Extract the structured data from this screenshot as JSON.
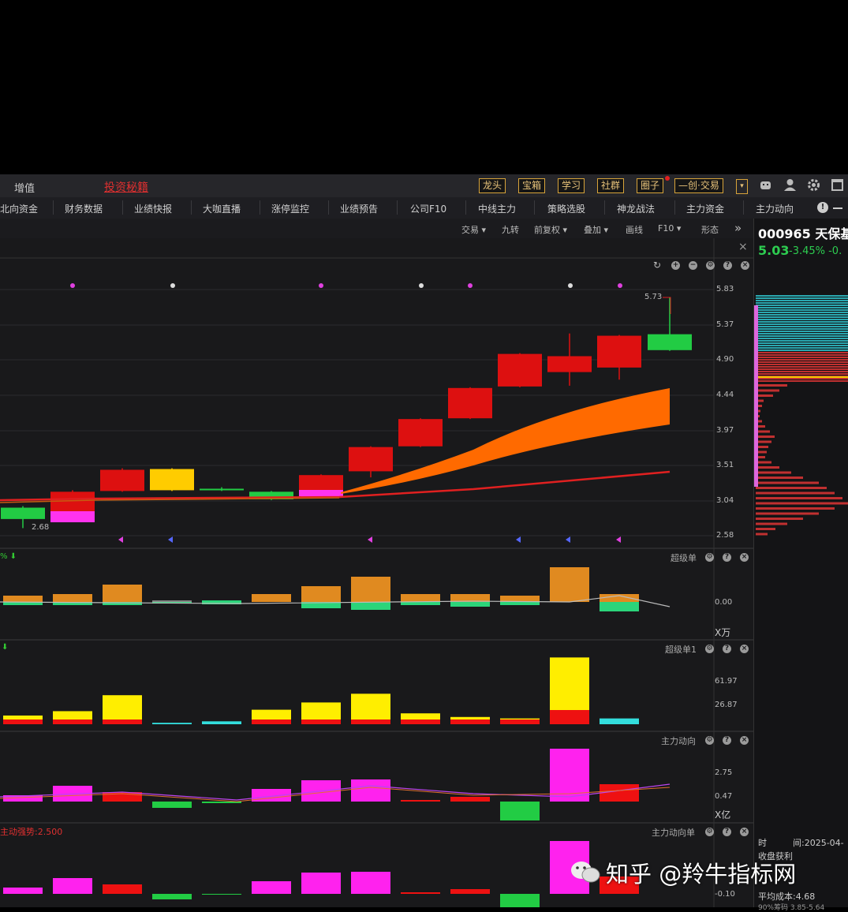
{
  "toolbar": {
    "left_label": "增值",
    "promo_label": "投资秘籍",
    "buttons": [
      "龙头",
      "宝箱",
      "学习",
      "社群",
      "圈子",
      "—创·交易"
    ]
  },
  "nav": {
    "items": [
      "北向资金",
      "财务数据",
      "业绩快报",
      "大咖直播",
      "涨停监控",
      "业绩预告",
      "公司F10",
      "中线主力",
      "策略选股",
      "神龙战法",
      "主力资金",
      "主力动向"
    ]
  },
  "chart_toolbar": {
    "items": [
      "交易 ▾",
      "九转",
      "前复权 ▾",
      "叠加 ▾",
      "画线",
      "F10 ▾",
      "形态"
    ]
  },
  "stock": {
    "title": "000965 天保基",
    "price": "5.03",
    "change": "-3.45% -0."
  },
  "chart_data": [
    {
      "type": "candlestick",
      "title": "",
      "y_ticks": [
        "5.83",
        "5.37",
        "4.90",
        "4.44",
        "3.97",
        "3.51",
        "3.04",
        "2.58"
      ],
      "ylim": [
        2.58,
        5.83
      ],
      "annotations": [
        "5.73",
        "2.68"
      ],
      "candles": [
        {
          "o": 2.95,
          "c": 2.8,
          "h": 2.97,
          "l": 2.68,
          "color": "#22cc44"
        },
        {
          "o": 2.86,
          "c": 3.16,
          "h": 3.18,
          "l": 2.85,
          "color": "#dd1010"
        },
        {
          "o": 3.17,
          "c": 3.45,
          "h": 3.47,
          "l": 3.16,
          "color": "#dd1010"
        },
        {
          "o": 3.18,
          "c": 3.46,
          "h": 3.47,
          "l": 3.17,
          "color": "#ffcc00"
        },
        {
          "o": 3.2,
          "c": 3.19,
          "h": 3.22,
          "l": 3.17,
          "color": "#22cc44"
        },
        {
          "o": 3.16,
          "c": 3.06,
          "h": 3.17,
          "l": 3.05,
          "color": "#22cc44"
        },
        {
          "o": 3.1,
          "c": 3.38,
          "h": 3.39,
          "l": 3.08,
          "color": "#dd1010"
        },
        {
          "o": 3.43,
          "c": 3.75,
          "h": 3.76,
          "l": 3.35,
          "color": "#dd1010"
        },
        {
          "o": 3.76,
          "c": 4.12,
          "h": 4.13,
          "l": 3.75,
          "color": "#dd1010"
        },
        {
          "o": 4.13,
          "c": 4.53,
          "h": 4.54,
          "l": 4.12,
          "color": "#dd1010"
        },
        {
          "o": 4.55,
          "c": 4.98,
          "h": 4.99,
          "l": 4.54,
          "color": "#dd1010"
        },
        {
          "o": 4.74,
          "c": 4.95,
          "h": 5.25,
          "l": 4.56,
          "color": "#dd1010"
        },
        {
          "o": 4.8,
          "c": 5.22,
          "h": 5.23,
          "l": 4.64,
          "color": "#dd1010"
        },
        {
          "o": 5.24,
          "c": 5.03,
          "h": 5.73,
          "l": 5.02,
          "color": "#22cc44"
        }
      ]
    },
    {
      "type": "bar",
      "title": "超级单",
      "y_ticks": [
        "0.00"
      ],
      "unit": "X万"
    },
    {
      "type": "bar",
      "title": "超级单1",
      "y_ticks": [
        "61.97",
        "26.87"
      ],
      "values": [
        12,
        18,
        40,
        2,
        4,
        20,
        30,
        42,
        15,
        10,
        8,
        92,
        8
      ]
    },
    {
      "type": "bar",
      "title": "主力动向",
      "y_ticks": [
        "2.75",
        "0.47"
      ],
      "unit": "X亿"
    },
    {
      "type": "bar",
      "title": "主力动向单",
      "y_ticks": [
        "-0.10"
      ],
      "annotations": [
        "主动强势:2.500"
      ]
    }
  ],
  "right_panel": {
    "time_label": "时",
    "date_label": "间:2025-04-",
    "close_label": "收盘获利",
    "avg_cost": "平均成本:4.68",
    "bottom_text": "90%筹码 3.85-5.64"
  },
  "watermark": "知乎 @羚牛指标网",
  "colors": {
    "up": "#dd1010",
    "down": "#22cc44",
    "accent": "#ff8800",
    "magenta": "#ff22ee"
  }
}
